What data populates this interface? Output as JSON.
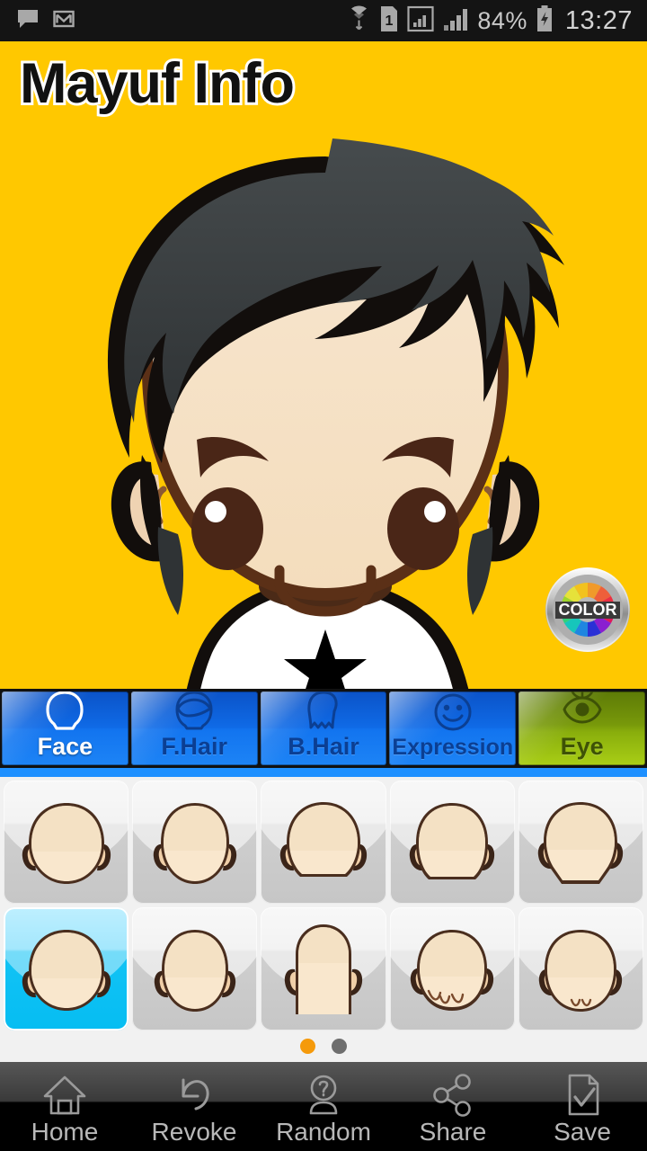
{
  "statusbar": {
    "left_icons": [
      "message-icon",
      "gmail-icon"
    ],
    "right_icons": [
      "wifi-icon",
      "sim-1-icon",
      "signal-bars-icon",
      "signal-strength-icon",
      "battery-charging-icon"
    ],
    "battery": "84%",
    "clock": "13:27"
  },
  "header": {
    "title": "Mayuf Info"
  },
  "stage": {
    "background_color": "#FFC800",
    "avatar": {
      "hair_color": "#3A3F41",
      "hair_outline": "#120E0C",
      "skin_color": "#F6E2C4",
      "eye_color": "#4A2617",
      "brow_color": "#5B3017",
      "shirt_color": "#FFFFFF",
      "shirt_emblem": "black-star"
    },
    "color_button": {
      "label": "COLOR",
      "icon": "color-wheel-icon"
    }
  },
  "tabs": [
    {
      "label": "Face",
      "icon": "face-outline-icon",
      "active": true,
      "theme": "blue"
    },
    {
      "label": "F.Hair",
      "icon": "front-hair-icon",
      "active": false,
      "theme": "blue"
    },
    {
      "label": "B.Hair",
      "icon": "back-hair-icon",
      "active": false,
      "theme": "blue"
    },
    {
      "label": "Expression",
      "icon": "smiley-face-icon",
      "active": false,
      "theme": "blue"
    },
    {
      "label": "Eye",
      "icon": "eye-icon",
      "active": false,
      "theme": "green"
    }
  ],
  "grid": {
    "items": [
      {
        "name": "face-round-wide",
        "shape": "round",
        "selected": false
      },
      {
        "name": "face-oval-narrow",
        "shape": "oval",
        "selected": false
      },
      {
        "name": "face-round-soft",
        "shape": "round2",
        "selected": false
      },
      {
        "name": "face-square-jaw",
        "shape": "square",
        "selected": false
      },
      {
        "name": "face-tapered-chin",
        "shape": "taper",
        "selected": false
      },
      {
        "name": "face-round-selected",
        "shape": "round",
        "selected": true
      },
      {
        "name": "face-egg",
        "shape": "egg",
        "selected": false
      },
      {
        "name": "face-long-rect",
        "shape": "long",
        "selected": false
      },
      {
        "name": "face-scalloped-jaw",
        "shape": "scallop",
        "selected": false
      },
      {
        "name": "face-pointed-chin",
        "shape": "pointed",
        "selected": false
      }
    ],
    "pages": 2,
    "current_page": 1
  },
  "bottom_nav": [
    {
      "label": "Home",
      "icon": "home-icon"
    },
    {
      "label": "Revoke",
      "icon": "undo-icon"
    },
    {
      "label": "Random",
      "icon": "person-question-icon"
    },
    {
      "label": "Share",
      "icon": "share-nodes-icon"
    },
    {
      "label": "Save",
      "icon": "document-check-icon"
    }
  ]
}
